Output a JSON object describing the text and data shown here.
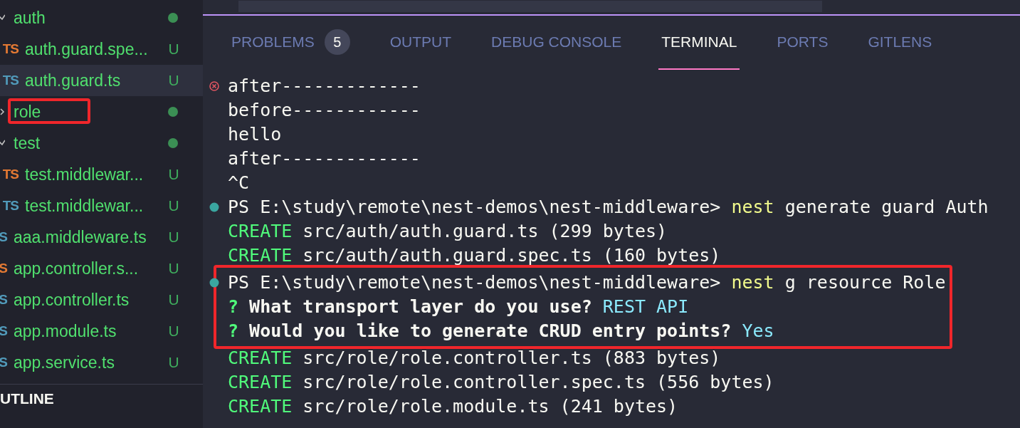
{
  "sidebar": {
    "tree": [
      {
        "kind": "folder",
        "name": "auth",
        "expanded": true,
        "selected": false,
        "annotated": false,
        "children": [
          {
            "kind": "file",
            "name": "auth.guard.spe...",
            "badge": "TS",
            "color": "#e37933",
            "status": "U",
            "selected": false,
            "annotated": false
          },
          {
            "kind": "file",
            "name": "auth.guard.ts",
            "badge": "TS",
            "color": "#519aba",
            "status": "U",
            "selected": true,
            "annotated": false
          }
        ]
      },
      {
        "kind": "folder",
        "name": "role",
        "expanded": false,
        "selected": false,
        "annotated": true
      },
      {
        "kind": "folder",
        "name": "test",
        "expanded": true,
        "selected": false,
        "annotated": false,
        "children": [
          {
            "kind": "file",
            "name": "test.middlewar...",
            "badge": "TS",
            "color": "#e37933",
            "status": "U",
            "selected": false,
            "annotated": false
          },
          {
            "kind": "file",
            "name": "test.middlewar...",
            "badge": "TS",
            "color": "#519aba",
            "status": "U",
            "selected": false,
            "annotated": false
          }
        ]
      },
      {
        "kind": "file",
        "name": "aaa.middleware.ts",
        "badge": "S",
        "color": "#519aba",
        "status": "U",
        "selected": false,
        "annotated": false
      },
      {
        "kind": "file",
        "name": "app.controller.s...",
        "badge": "S",
        "color": "#e37933",
        "status": "U",
        "selected": false,
        "annotated": false
      },
      {
        "kind": "file",
        "name": "app.controller.ts",
        "badge": "S",
        "color": "#519aba",
        "status": "U",
        "selected": false,
        "annotated": false
      },
      {
        "kind": "file",
        "name": "app.module.ts",
        "badge": "S",
        "color": "#519aba",
        "status": "U",
        "selected": false,
        "annotated": false
      },
      {
        "kind": "file",
        "name": "app.service.ts",
        "badge": "S",
        "color": "#519aba",
        "status": "U",
        "selected": false,
        "annotated": false
      }
    ],
    "sections": [
      "UTLINE"
    ]
  },
  "panel": {
    "tabs": [
      {
        "label": "PROBLEMS",
        "count": "5",
        "selected": false
      },
      {
        "label": "OUTPUT",
        "selected": false
      },
      {
        "label": "DEBUG CONSOLE",
        "selected": false
      },
      {
        "label": "TERMINAL",
        "selected": true
      },
      {
        "label": "PORTS",
        "selected": false
      },
      {
        "label": "GITLENS",
        "selected": false
      }
    ],
    "terminal": [
      {
        "kind": "error",
        "annotated": false,
        "segments": [
          {
            "text": "after-------------",
            "kind": "plain"
          }
        ]
      },
      {
        "kind": "output",
        "annotated": false,
        "segments": [
          {
            "text": "before------------",
            "kind": "plain"
          }
        ]
      },
      {
        "kind": "output",
        "annotated": false,
        "segments": [
          {
            "text": "hello",
            "kind": "plain"
          }
        ]
      },
      {
        "kind": "output",
        "annotated": false,
        "segments": [
          {
            "text": "after-------------",
            "kind": "plain"
          }
        ]
      },
      {
        "kind": "output",
        "annotated": false,
        "segments": [
          {
            "text": "^C",
            "kind": "plain"
          }
        ]
      },
      {
        "kind": "command",
        "annotated": false,
        "segments": [
          {
            "text": "PS E:\\study\\remote\\nest-demos\\nest-middleware> ",
            "kind": "plain"
          },
          {
            "text": "nest",
            "kind": "command"
          },
          {
            "text": " generate guard Auth",
            "kind": "plain"
          }
        ]
      },
      {
        "kind": "output",
        "annotated": false,
        "segments": [
          {
            "text": "CREATE",
            "kind": "create"
          },
          {
            "text": " src/auth/auth.guard.ts (299 bytes)",
            "kind": "plain"
          }
        ]
      },
      {
        "kind": "output",
        "annotated": false,
        "segments": [
          {
            "text": "CREATE",
            "kind": "create"
          },
          {
            "text": " src/auth/auth.guard.spec.ts (160 bytes)",
            "kind": "plain"
          }
        ]
      },
      {
        "kind": "command",
        "annotated": true,
        "segments": [
          {
            "text": "PS E:\\study\\remote\\nest-demos\\nest-middleware> ",
            "kind": "plain"
          },
          {
            "text": "nest",
            "kind": "command"
          },
          {
            "text": " g resource Role",
            "kind": "plain"
          }
        ]
      },
      {
        "kind": "output",
        "annotated": true,
        "segments": [
          {
            "text": "?",
            "kind": "question"
          },
          {
            "text": " What transport layer do you use? ",
            "kind": "prompt"
          },
          {
            "text": "REST API",
            "kind": "answer"
          }
        ]
      },
      {
        "kind": "output",
        "annotated": true,
        "segments": [
          {
            "text": "?",
            "kind": "question"
          },
          {
            "text": " Would you like to generate CRUD entry points? ",
            "kind": "prompt"
          },
          {
            "text": "Yes",
            "kind": "answer"
          }
        ]
      },
      {
        "kind": "output",
        "annotated": false,
        "segments": [
          {
            "text": "CREATE",
            "kind": "create"
          },
          {
            "text": " src/role/role.controller.ts (883 bytes)",
            "kind": "plain"
          }
        ]
      },
      {
        "kind": "output",
        "annotated": false,
        "segments": [
          {
            "text": "CREATE",
            "kind": "create"
          },
          {
            "text": " src/role/role.controller.spec.ts (556 bytes)",
            "kind": "plain"
          }
        ]
      },
      {
        "kind": "output",
        "annotated": false,
        "segments": [
          {
            "text": "CREATE",
            "kind": "create"
          },
          {
            "text": " src/role/role.module.ts (241 bytes)",
            "kind": "plain"
          }
        ]
      }
    ]
  }
}
